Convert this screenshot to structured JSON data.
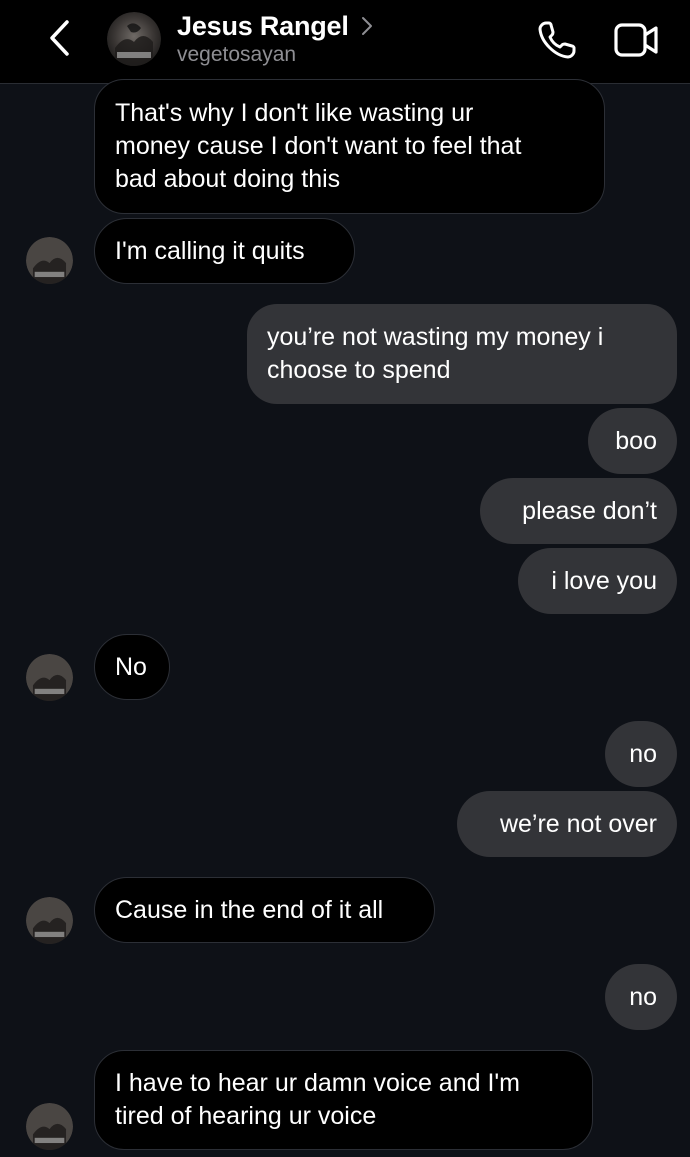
{
  "header": {
    "name": "Jesus Rangel",
    "username": "vegetosayan",
    "icons": {
      "back": "chevron-left-icon",
      "profile_chevron": "chevron-right-icon",
      "call": "phone-icon",
      "video": "video-camera-icon"
    }
  },
  "messages": [
    {
      "sender": "them",
      "text": "That's why I don't like wasting ur\nmoney cause I don't want to feel that\nbad about doing this"
    },
    {
      "sender": "them",
      "text": "I'm calling it quits"
    },
    {
      "sender": "me",
      "text": "you’re not wasting my money i\nchoose to spend"
    },
    {
      "sender": "me",
      "text": "boo"
    },
    {
      "sender": "me",
      "text": "please don’t"
    },
    {
      "sender": "me",
      "text": "i love you"
    },
    {
      "sender": "them",
      "text": "No"
    },
    {
      "sender": "me",
      "text": "no"
    },
    {
      "sender": "me",
      "text": "we’re not over"
    },
    {
      "sender": "them",
      "text": "Cause in the end of it all"
    },
    {
      "sender": "me",
      "text": "no"
    },
    {
      "sender": "them",
      "text": "I have to hear ur damn voice and I'm\ntired of hearing ur voice"
    }
  ],
  "colors": {
    "background": "#0e1117",
    "header_bg": "#000000",
    "incoming_bubble": "#000000",
    "incoming_border": "#2c2f36",
    "outgoing_bubble": "#333438",
    "username_gray": "#8e8e93"
  }
}
